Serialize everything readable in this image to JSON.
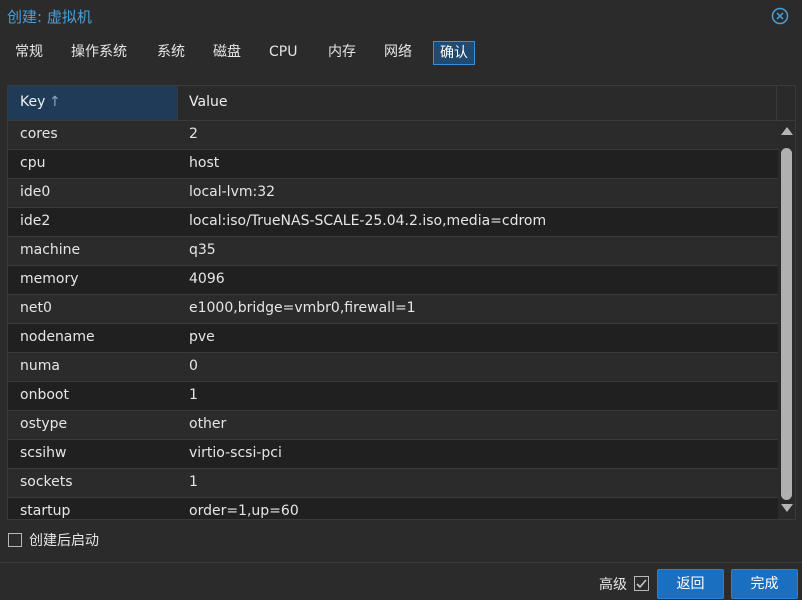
{
  "window": {
    "title": "创建: 虚拟机"
  },
  "tabs": [
    {
      "label": "常规"
    },
    {
      "label": "操作系统"
    },
    {
      "label": "系统"
    },
    {
      "label": "磁盘"
    },
    {
      "label": "CPU"
    },
    {
      "label": "内存"
    },
    {
      "label": "网络"
    },
    {
      "label": "确认",
      "active": true
    }
  ],
  "grid": {
    "columns": {
      "key": "Key",
      "value": "Value"
    },
    "sort_indicator": "↑",
    "rows": [
      {
        "key": "cores",
        "value": "2"
      },
      {
        "key": "cpu",
        "value": "host"
      },
      {
        "key": "ide0",
        "value": "local-lvm:32"
      },
      {
        "key": "ide2",
        "value": "local:iso/TrueNAS-SCALE-25.04.2.iso,media=cdrom"
      },
      {
        "key": "machine",
        "value": "q35"
      },
      {
        "key": "memory",
        "value": "4096"
      },
      {
        "key": "net0",
        "value": "e1000,bridge=vmbr0,firewall=1"
      },
      {
        "key": "nodename",
        "value": "pve"
      },
      {
        "key": "numa",
        "value": "0"
      },
      {
        "key": "onboot",
        "value": "1"
      },
      {
        "key": "ostype",
        "value": "other"
      },
      {
        "key": "scsihw",
        "value": "virtio-scsi-pci"
      },
      {
        "key": "sockets",
        "value": "1"
      },
      {
        "key": "startup",
        "value": "order=1,up=60"
      }
    ]
  },
  "autostart": {
    "label": "创建后启动",
    "checked": false
  },
  "footer": {
    "advanced_label": "高级",
    "advanced_checked": true,
    "back_label": "返回",
    "finish_label": "完成"
  },
  "colors": {
    "accent": "#1a6fc0",
    "title": "#4a9fd8",
    "background": "#2b2b2b"
  },
  "icons": {
    "close": "close-circle-icon",
    "checkmark": "checkmark-icon"
  }
}
